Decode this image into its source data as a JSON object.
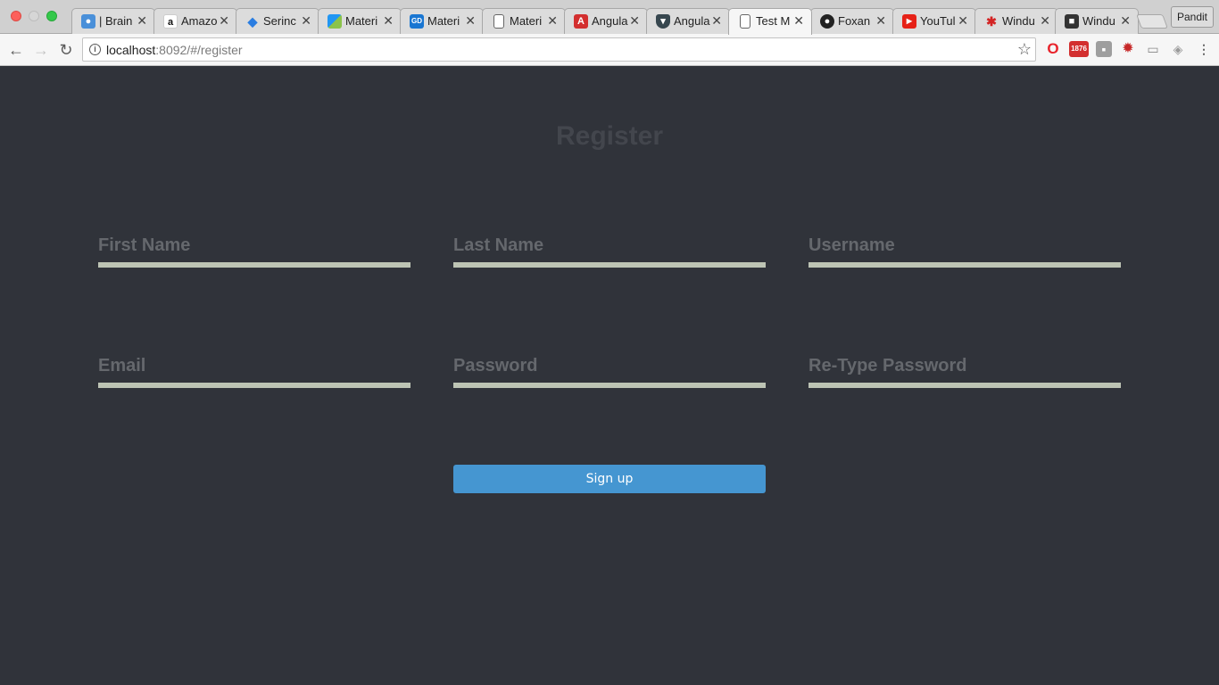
{
  "browser": {
    "tabs": [
      {
        "title": "| Brain",
        "icon": "brain-icon",
        "color": "#4a90d9"
      },
      {
        "title": "Amazo",
        "icon": "amazon-icon",
        "color": "#ffffff"
      },
      {
        "title": "Serinc",
        "icon": "serinc-icon",
        "color": "#2a7de1"
      },
      {
        "title": "Materi",
        "icon": "material-icon",
        "color": "#3dbb5b"
      },
      {
        "title": "Materi",
        "icon": "gd-icon",
        "color": "#1976d2"
      },
      {
        "title": "Materi",
        "icon": "page-icon",
        "color": "#ffffff"
      },
      {
        "title": "Angula",
        "icon": "angular-icon",
        "color": "#d32f2f"
      },
      {
        "title": "Angula",
        "icon": "shield-icon",
        "color": "#37474f"
      },
      {
        "title": "Test M",
        "icon": "page-icon",
        "color": "#ffffff"
      },
      {
        "title": "Foxan",
        "icon": "github-icon",
        "color": "#222222"
      },
      {
        "title": "YouTul",
        "icon": "youtube-icon",
        "color": "#e62117"
      },
      {
        "title": "Windu",
        "icon": "yelp-icon",
        "color": "#d32323"
      },
      {
        "title": "Windu",
        "icon": "cube-icon",
        "color": "#333333"
      }
    ],
    "profile_name": "Pandit",
    "url_host": "localhost",
    "url_rest": ":8092/#/register",
    "extensions": [
      "opera-icon",
      "gmail-1876-icon",
      "pocket-icon",
      "bug-icon",
      "cast-icon",
      "dropbox-icon",
      "menu-dots-icon"
    ]
  },
  "page": {
    "title": "Register",
    "fields": {
      "first_name": "First Name",
      "last_name": "Last Name",
      "username": "Username",
      "email": "Email",
      "password": "Password",
      "retype_password": "Re-Type Password"
    },
    "signup_label": "Sign up"
  },
  "colors": {
    "background": "#30333a",
    "field_underline": "#bdc4b4",
    "button": "#4596d1"
  }
}
